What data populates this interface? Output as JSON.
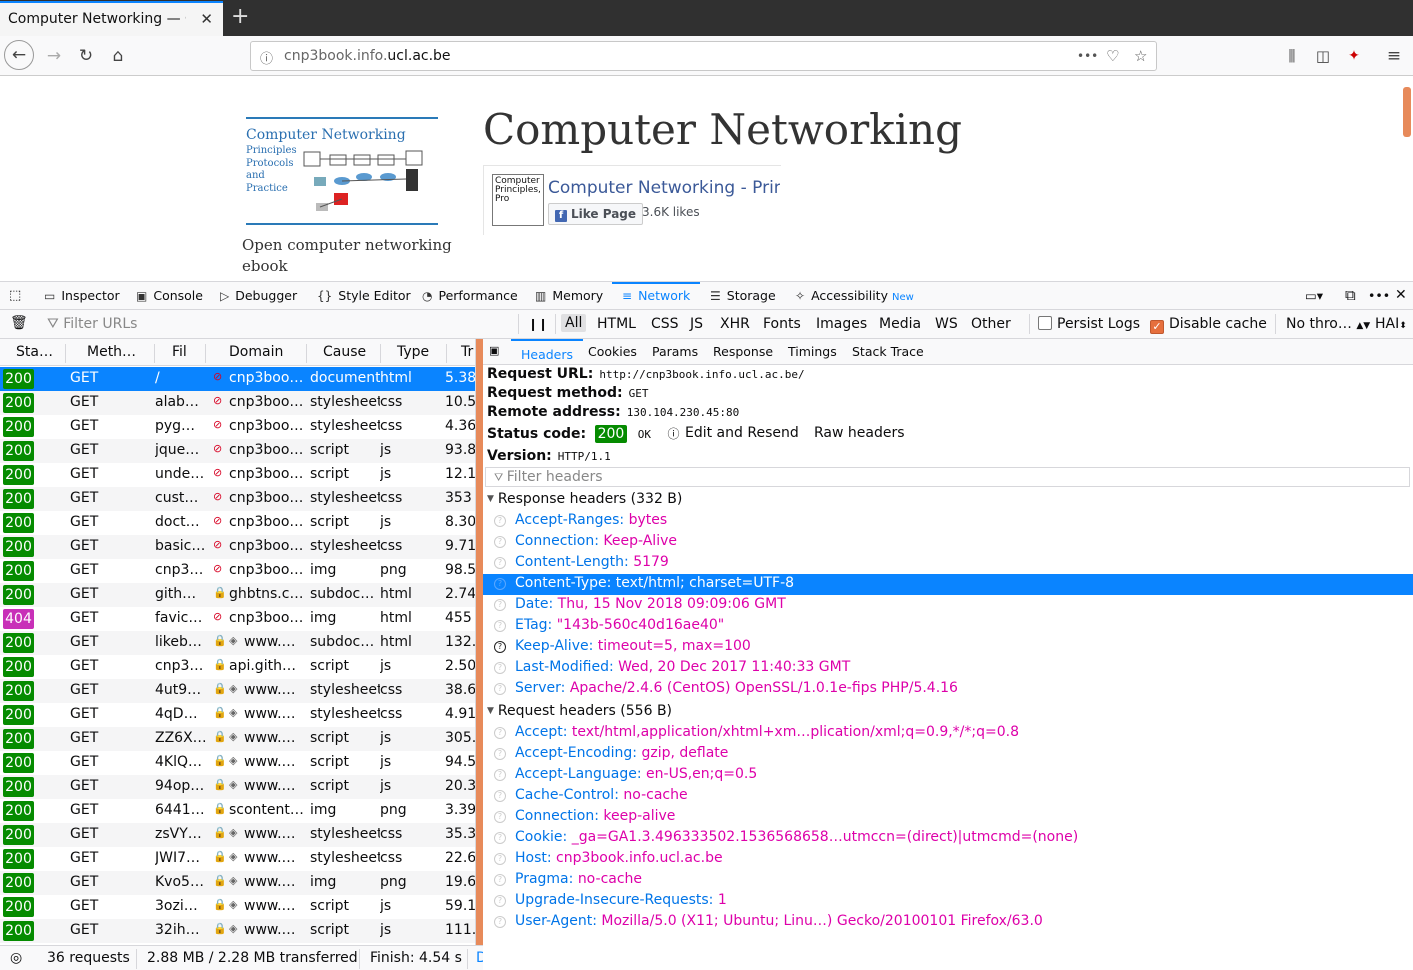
{
  "browser": {
    "tab_title": "Computer Networking — C",
    "tab_close": "✕",
    "new_tab": "+",
    "url_domain_prefix": "cnp3book.info.",
    "url_domain_main": "ucl.ac.be",
    "url_more": "•••"
  },
  "page": {
    "logo_title": "Computer Networking",
    "logo_subtitle": [
      "Principles",
      "Protocols",
      "and",
      "Practice"
    ],
    "tagline": "Open computer networking ebook",
    "title": "Computer Networking",
    "fb_image_text": "Computer Principles, Pro",
    "fb_name": "Computer Networking - Princi",
    "fb_like": "Like Page",
    "fb_likes": "3.6K likes"
  },
  "devtools": {
    "tabs": [
      "Inspector",
      "Console",
      "Debugger",
      "Style Editor",
      "Performance",
      "Memory",
      "Network",
      "Storage",
      "Accessibility"
    ],
    "new_badge": "New",
    "filter_placeholder": "Filter URLs",
    "type_filters": [
      "All",
      "HTML",
      "CSS",
      "JS",
      "XHR",
      "Fonts",
      "Images",
      "Media",
      "WS",
      "Other"
    ],
    "persist_logs": "Persist Logs",
    "disable_cache": "Disable cache",
    "throttle": "No thro…",
    "har": "HAI"
  },
  "list": {
    "columns": [
      "Sta…",
      "Meth…",
      "Fil",
      "Domain",
      "Cause",
      "Type",
      "Tr"
    ],
    "rows": [
      {
        "status": "200",
        "method": "GET",
        "file": "/",
        "domain": "cnp3boo…",
        "cause": "document",
        "type": "html",
        "tr": "5.38"
      },
      {
        "status": "200",
        "method": "GET",
        "file": "alab…",
        "domain": "cnp3boo…",
        "cause": "stylesheet",
        "type": "css",
        "tr": "10.5"
      },
      {
        "status": "200",
        "method": "GET",
        "file": "pyg…",
        "domain": "cnp3boo…",
        "cause": "stylesheet",
        "type": "css",
        "tr": "4.36"
      },
      {
        "status": "200",
        "method": "GET",
        "file": "jque…",
        "domain": "cnp3boo…",
        "cause": "script",
        "type": "js",
        "tr": "93.8"
      },
      {
        "status": "200",
        "method": "GET",
        "file": "unde…",
        "domain": "cnp3boo…",
        "cause": "script",
        "type": "js",
        "tr": "12.1"
      },
      {
        "status": "200",
        "method": "GET",
        "file": "cust…",
        "domain": "cnp3boo…",
        "cause": "stylesheet",
        "type": "css",
        "tr": "353"
      },
      {
        "status": "200",
        "method": "GET",
        "file": "doct…",
        "domain": "cnp3boo…",
        "cause": "script",
        "type": "js",
        "tr": "8.30"
      },
      {
        "status": "200",
        "method": "GET",
        "file": "basic…",
        "domain": "cnp3boo…",
        "cause": "stylesheet",
        "type": "css",
        "tr": "9.71"
      },
      {
        "status": "200",
        "method": "GET",
        "file": "cnp3…",
        "domain": "cnp3boo…",
        "cause": "img",
        "type": "png",
        "tr": "98.5"
      },
      {
        "status": "200",
        "method": "GET",
        "file": "gith…",
        "domain": "ghbtns.c…",
        "cause": "subdoc…",
        "type": "html",
        "tr": "2.74"
      },
      {
        "status": "404",
        "method": "GET",
        "file": "favic…",
        "domain": "cnp3boo…",
        "cause": "img",
        "type": "html",
        "tr": "455"
      },
      {
        "status": "200",
        "method": "GET",
        "file": "likeb…",
        "domain": "www.…",
        "cause": "subdoc…",
        "type": "html",
        "tr": "132."
      },
      {
        "status": "200",
        "method": "GET",
        "file": "cnp3…",
        "domain": "api.gith…",
        "cause": "script",
        "type": "js",
        "tr": "2.50"
      },
      {
        "status": "200",
        "method": "GET",
        "file": "4ut9…",
        "domain": "www.…",
        "cause": "stylesheet",
        "type": "css",
        "tr": "38.6"
      },
      {
        "status": "200",
        "method": "GET",
        "file": "4qD…",
        "domain": "www.…",
        "cause": "stylesheet",
        "type": "css",
        "tr": "4.91"
      },
      {
        "status": "200",
        "method": "GET",
        "file": "ZZ6X…",
        "domain": "www.…",
        "cause": "script",
        "type": "js",
        "tr": "305."
      },
      {
        "status": "200",
        "method": "GET",
        "file": "4KlQ…",
        "domain": "www.…",
        "cause": "script",
        "type": "js",
        "tr": "94.5"
      },
      {
        "status": "200",
        "method": "GET",
        "file": "94op…",
        "domain": "www.…",
        "cause": "script",
        "type": "js",
        "tr": "20.3"
      },
      {
        "status": "200",
        "method": "GET",
        "file": "6441…",
        "domain": "scontent…",
        "cause": "img",
        "type": "png",
        "tr": "3.39"
      },
      {
        "status": "200",
        "method": "GET",
        "file": "zsVY…",
        "domain": "www.…",
        "cause": "stylesheet",
        "type": "css",
        "tr": "35.3"
      },
      {
        "status": "200",
        "method": "GET",
        "file": "JWI7…",
        "domain": "www.…",
        "cause": "stylesheet",
        "type": "css",
        "tr": "22.6"
      },
      {
        "status": "200",
        "method": "GET",
        "file": "Kvo5…",
        "domain": "www.…",
        "cause": "img",
        "type": "png",
        "tr": "19.6"
      },
      {
        "status": "200",
        "method": "GET",
        "file": "3ozi…",
        "domain": "www.…",
        "cause": "script",
        "type": "js",
        "tr": "59.1"
      },
      {
        "status": "200",
        "method": "GET",
        "file": "32ih…",
        "domain": "www.…",
        "cause": "script",
        "type": "js",
        "tr": "111."
      }
    ],
    "footer_requests": "36 requests",
    "footer_size": "2.88 MB / 2.28 MB transferred",
    "footer_finish": "Finish: 4.54 s",
    "footer_extra": "D"
  },
  "details": {
    "tabs": [
      "Headers",
      "Cookies",
      "Params",
      "Response",
      "Timings",
      "Stack Trace"
    ],
    "request_url_label": "Request URL:",
    "request_url": "http://cnp3book.info.ucl.ac.be/",
    "method_label": "Request method:",
    "method": "GET",
    "remote_label": "Remote address:",
    "remote": "130.104.230.45:80",
    "status_label": "Status code:",
    "status": "200",
    "status_text": "OK",
    "edit_resend": "Edit and Resend",
    "raw_headers": "Raw headers",
    "version_label": "Version:",
    "version": "HTTP/1.1",
    "filter_headers": "Filter headers",
    "response_section": "Response headers (332 B)",
    "response_headers": [
      {
        "k": "Accept-Ranges:",
        "v": "bytes"
      },
      {
        "k": "Connection:",
        "v": "Keep-Alive"
      },
      {
        "k": "Content-Length:",
        "v": "5179"
      },
      {
        "k": "Content-Type:",
        "v": "text/html; charset=UTF-8"
      },
      {
        "k": "Date:",
        "v": "Thu, 15 Nov 2018 09:09:06 GMT"
      },
      {
        "k": "ETag:",
        "v": "\"143b-560c40d16ae40\""
      },
      {
        "k": "Keep-Alive:",
        "v": "timeout=5, max=100"
      },
      {
        "k": "Last-Modified:",
        "v": "Wed, 20 Dec 2017 11:40:33 GMT"
      },
      {
        "k": "Server:",
        "v": "Apache/2.4.6 (CentOS) OpenSSL/1.0.1e-fips PHP/5.4.16"
      }
    ],
    "request_section": "Request headers (556 B)",
    "request_headers": [
      {
        "k": "Accept:",
        "v": "text/html,application/xhtml+xm…plication/xml;q=0.9,*/*;q=0.8"
      },
      {
        "k": "Accept-Encoding:",
        "v": "gzip, deflate"
      },
      {
        "k": "Accept-Language:",
        "v": "en-US,en;q=0.5"
      },
      {
        "k": "Cache-Control:",
        "v": "no-cache"
      },
      {
        "k": "Connection:",
        "v": "keep-alive"
      },
      {
        "k": "Cookie:",
        "v": "_ga=GA1.3.496333502.1536568658…utmccn=(direct)|utmcmd=(none)"
      },
      {
        "k": "Host:",
        "v": "cnp3book.info.ucl.ac.be"
      },
      {
        "k": "Pragma:",
        "v": "no-cache"
      },
      {
        "k": "Upgrade-Insecure-Requests:",
        "v": "1"
      },
      {
        "k": "User-Agent:",
        "v": "Mozilla/5.0 (X11; Ubuntu; Linu…) Gecko/20100101 Firefox/63.0"
      }
    ]
  }
}
